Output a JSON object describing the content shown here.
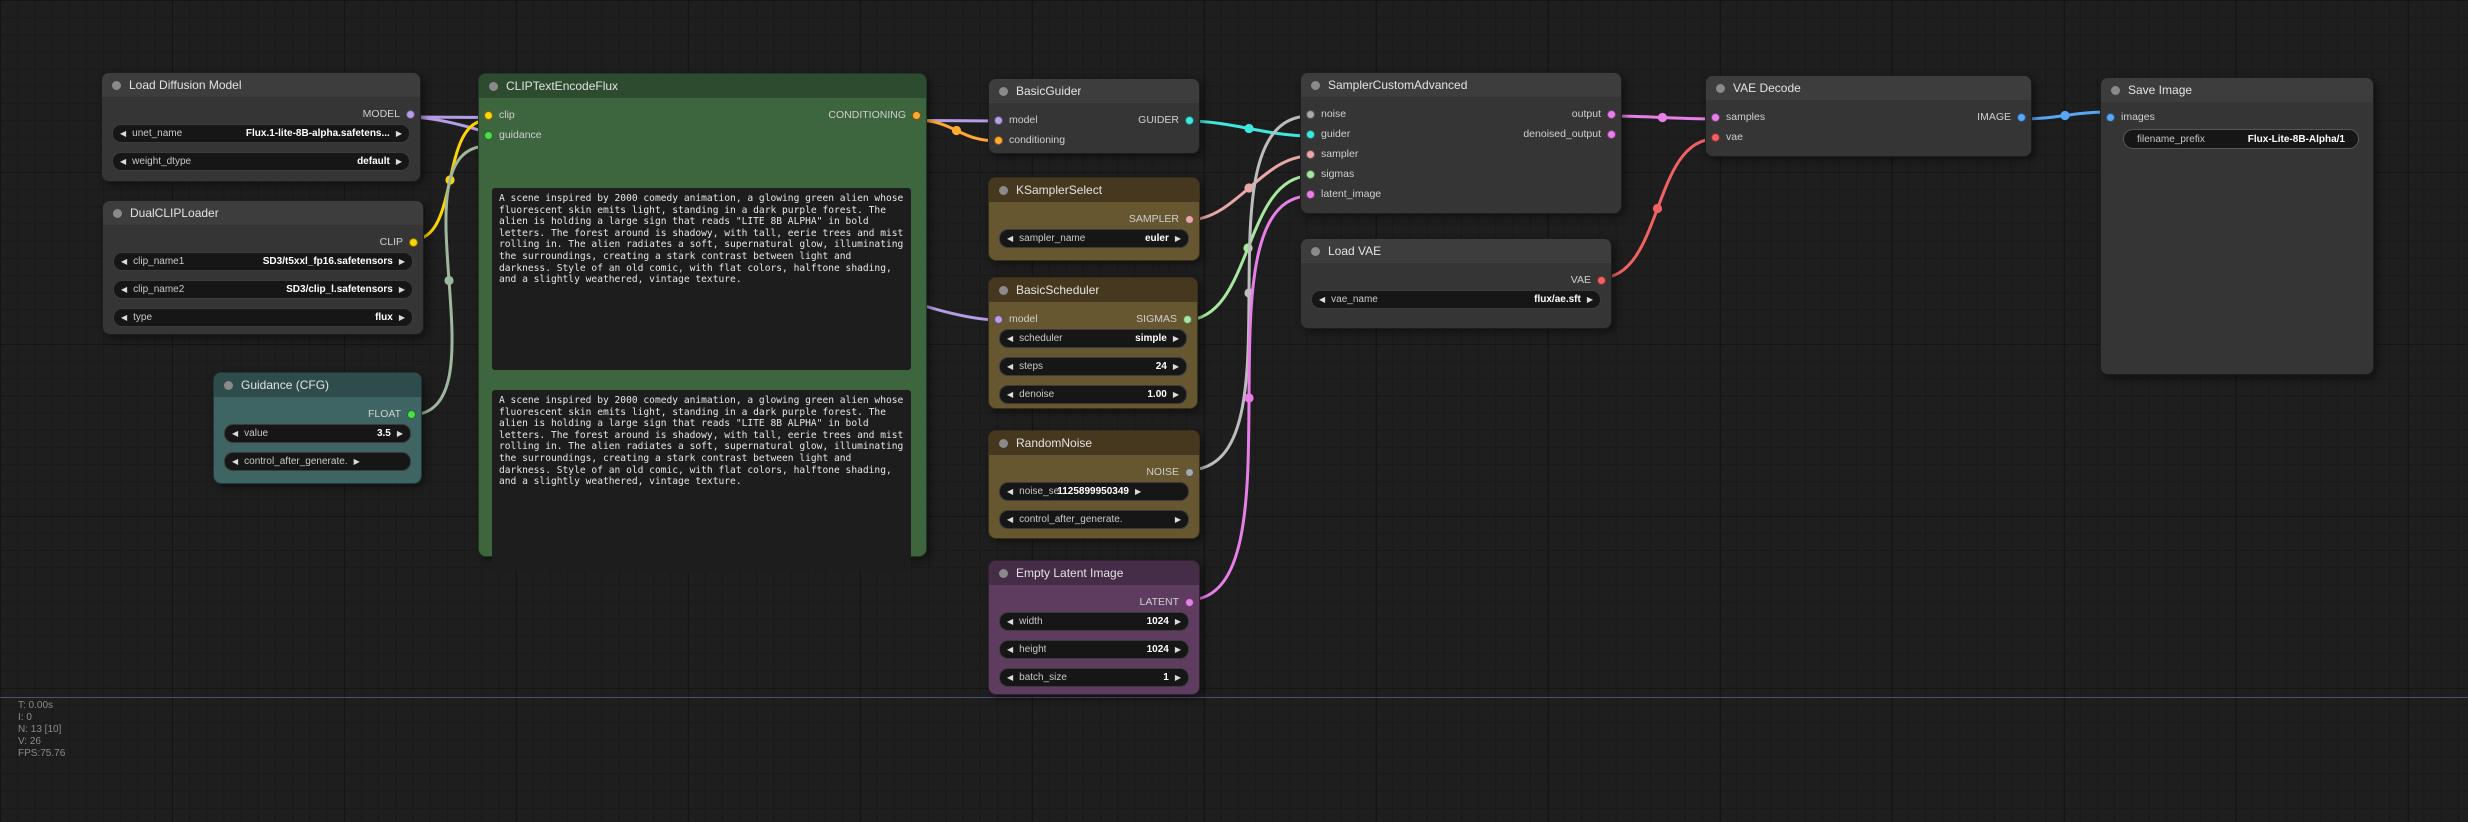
{
  "canvas": {
    "stats": [
      "T: 0.00s",
      "I: 0",
      "N: 13 [10]",
      "V: 26",
      "FPS:75.76"
    ],
    "guide_line_color": "#7878be"
  },
  "node_colors": {
    "default": {
      "title": "#3d3d3d",
      "body": "#353535"
    },
    "green": {
      "title": "#2d4b2f",
      "body": "#3e663e"
    },
    "teal": {
      "title": "#2e4c4c",
      "body": "#3f6464"
    },
    "brown": {
      "title": "#46381f",
      "body": "#665731"
    },
    "purple": {
      "title": "#452c47",
      "body": "#5e3c60"
    }
  },
  "slot_colors": {
    "MODEL": "#b79ce6",
    "CLIP": "#ffd500",
    "FLOAT": "#4ade4a",
    "CONDITIONING": "#ffa931",
    "GUIDER": "#3fe8dc",
    "SAMPLER": "#eaa7a7",
    "SIGMAS": "#a9e6a1",
    "NOISE": "#a8a8a8",
    "LATENT": "#e87fe8",
    "VAE": "#f16161",
    "IMAGE": "#58a6f5"
  },
  "nodes": {
    "load_diffusion_model": {
      "title": "Load Diffusion Model",
      "outputs": [
        {
          "label": "MODEL"
        }
      ],
      "widgets": [
        {
          "label": "unet_name",
          "value": "Flux.1-lite-8B-alpha.safetens..."
        },
        {
          "label": "weight_dtype",
          "value": "default"
        }
      ]
    },
    "dual_clip_loader": {
      "title": "DualCLIPLoader",
      "outputs": [
        {
          "label": "CLIP"
        }
      ],
      "widgets": [
        {
          "label": "clip_name1",
          "value": "SD3/t5xxl_fp16.safetensors"
        },
        {
          "label": "clip_name2",
          "value": "SD3/clip_l.safetensors"
        },
        {
          "label": "type",
          "value": "flux"
        }
      ]
    },
    "guidance_cfg": {
      "title": "Guidance (CFG)",
      "outputs": [
        {
          "label": "FLOAT"
        }
      ],
      "widgets": [
        {
          "label": "value",
          "value": "3.5"
        },
        {
          "label": "control_after_generate.",
          "value": ""
        }
      ]
    },
    "clip_text_encode_flux": {
      "title": "CLIPTextEncodeFlux",
      "inputs": [
        {
          "label": "clip"
        },
        {
          "label": "guidance"
        }
      ],
      "outputs": [
        {
          "label": "CONDITIONING"
        }
      ],
      "prompts": [
        "A scene inspired by 2000 comedy animation, a glowing green alien whose fluorescent skin emits light, standing in a dark purple forest. The alien is holding a large sign that reads \"LITE 8B ALPHA\" in bold letters. The forest around is shadowy, with tall, eerie trees and mist rolling in. The alien radiates a soft, supernatural glow, illuminating the surroundings, creating a stark contrast between light and darkness. Style of an old comic, with flat colors, halftone shading, and a slightly weathered, vintage texture.",
        "A scene inspired by 2000 comedy animation, a glowing green alien whose fluorescent skin emits light, standing in a dark purple forest. The alien is holding a large sign that reads \"LITE 8B ALPHA\" in bold letters. The forest around is shadowy, with tall, eerie trees and mist rolling in. The alien radiates a soft, supernatural glow, illuminating the surroundings, creating a stark contrast between light and darkness. Style of an old comic, with flat colors, halftone shading, and a slightly weathered, vintage texture."
      ]
    },
    "basic_guider": {
      "title": "BasicGuider",
      "inputs": [
        {
          "label": "model"
        },
        {
          "label": "conditioning"
        }
      ],
      "outputs": [
        {
          "label": "GUIDER"
        }
      ]
    },
    "ksampler_select": {
      "title": "KSamplerSelect",
      "outputs": [
        {
          "label": "SAMPLER"
        }
      ],
      "widgets": [
        {
          "label": "sampler_name",
          "value": "euler"
        }
      ]
    },
    "basic_scheduler": {
      "title": "BasicScheduler",
      "inputs": [
        {
          "label": "model"
        }
      ],
      "outputs": [
        {
          "label": "SIGMAS"
        }
      ],
      "widgets": [
        {
          "label": "scheduler",
          "value": "simple"
        },
        {
          "label": "steps",
          "value": "24"
        },
        {
          "label": "denoise",
          "value": "1.00"
        }
      ]
    },
    "random_noise": {
      "title": "RandomNoise",
      "outputs": [
        {
          "label": "NOISE"
        }
      ],
      "widgets": [
        {
          "label": "noise_se",
          "value": "1125899950349"
        },
        {
          "label": "control_after_generate.",
          "value": ""
        }
      ]
    },
    "empty_latent_image": {
      "title": "Empty Latent Image",
      "outputs": [
        {
          "label": "LATENT"
        }
      ],
      "widgets": [
        {
          "label": "width",
          "value": "1024"
        },
        {
          "label": "height",
          "value": "1024"
        },
        {
          "label": "batch_size",
          "value": "1"
        }
      ]
    },
    "sampler_custom_advanced": {
      "title": "SamplerCustomAdvanced",
      "inputs": [
        {
          "label": "noise"
        },
        {
          "label": "guider"
        },
        {
          "label": "sampler"
        },
        {
          "label": "sigmas"
        },
        {
          "label": "latent_image"
        }
      ],
      "outputs": [
        {
          "label": "output"
        },
        {
          "label": "denoised_output"
        }
      ]
    },
    "load_vae": {
      "title": "Load VAE",
      "outputs": [
        {
          "label": "VAE"
        }
      ],
      "widgets": [
        {
          "label": "vae_name",
          "value": "flux/ae.sft"
        }
      ]
    },
    "vae_decode": {
      "title": "VAE Decode",
      "inputs": [
        {
          "label": "samples"
        },
        {
          "label": "vae"
        }
      ],
      "outputs": [
        {
          "label": "IMAGE"
        }
      ]
    },
    "save_image": {
      "title": "Save Image",
      "inputs": [
        {
          "label": "images"
        }
      ],
      "widgets": [
        {
          "label": "filename_prefix",
          "value": "Flux-Lite-8B-Alpha/1"
        }
      ]
    }
  },
  "links": [
    {
      "from": "load_diffusion_model.MODEL",
      "to": "basic_guider.model",
      "color": "#b79ce6"
    },
    {
      "from": "load_diffusion_model.MODEL",
      "to": "basic_scheduler.model",
      "color": "#b79ce6"
    },
    {
      "from": "dual_clip_loader.CLIP",
      "to": "clip_text_encode_flux.clip",
      "color": "#ffd500"
    },
    {
      "from": "guidance_cfg.FLOAT",
      "to": "clip_text_encode_flux.guidance",
      "color": "#9db89d"
    },
    {
      "from": "clip_text_encode_flux.CONDITIONING",
      "to": "basic_guider.conditioning",
      "color": "#ffa931"
    },
    {
      "from": "basic_guider.GUIDER",
      "to": "sampler_custom_advanced.guider",
      "color": "#3fe8dc"
    },
    {
      "from": "ksampler_select.SAMPLER",
      "to": "sampler_custom_advanced.sampler",
      "color": "#eaa7a7"
    },
    {
      "from": "basic_scheduler.SIGMAS",
      "to": "sampler_custom_advanced.sigmas",
      "color": "#a9e6a1"
    },
    {
      "from": "random_noise.NOISE",
      "to": "sampler_custom_advanced.noise",
      "color": "#bdbdbd"
    },
    {
      "from": "empty_latent_image.LATENT",
      "to": "sampler_custom_advanced.latent_image",
      "color": "#e87fe8"
    },
    {
      "from": "sampler_custom_advanced.output",
      "to": "vae_decode.samples",
      "color": "#e87fe8"
    },
    {
      "from": "load_vae.VAE",
      "to": "vae_decode.vae",
      "color": "#f16161"
    },
    {
      "from": "vae_decode.IMAGE",
      "to": "save_image.images",
      "color": "#58a6f5"
    }
  ]
}
